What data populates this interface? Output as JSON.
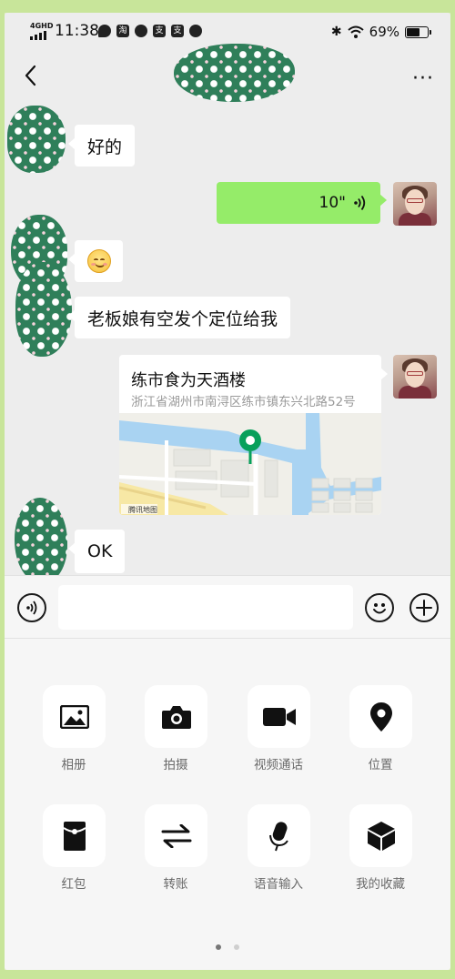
{
  "status_bar": {
    "network": "4GHD",
    "time": "11:38",
    "app_icons": [
      "chat-bubble-icon",
      "taobao-icon",
      "alipay-icon",
      "alipay-icon",
      "hd-icon"
    ],
    "app_icon_chars": [
      "",
      "淘",
      "",
      "支",
      "支"
    ],
    "battery_text": "69%",
    "battery_level": 0.69
  },
  "header": {
    "back_icon": "chevron-left-icon",
    "more_icon": "more-dots-icon",
    "more_label": "···"
  },
  "messages": [
    {
      "side": "left",
      "type": "text",
      "text": "好的"
    },
    {
      "side": "right",
      "type": "voice",
      "text": "10\""
    },
    {
      "side": "left",
      "type": "emoji",
      "emoji": "smiling-face"
    },
    {
      "side": "left",
      "type": "text",
      "text": "老板娘有空发个定位给我"
    },
    {
      "side": "right",
      "type": "location",
      "name": "练市食为天酒楼",
      "address": "浙江省湖州市南浔区练市镇东兴北路52号",
      "map_provider": "腾讯地图"
    },
    {
      "side": "left",
      "type": "text",
      "text": "OK"
    }
  ],
  "input_bar": {
    "voice_icon": "voice-mode-icon",
    "value": "",
    "emoji_icon": "emoji-icon",
    "plus_icon": "plus-icon"
  },
  "panel": {
    "items": [
      {
        "label": "相册",
        "icon": "photo-album-icon"
      },
      {
        "label": "拍摄",
        "icon": "camera-icon"
      },
      {
        "label": "视频通话",
        "icon": "video-call-icon"
      },
      {
        "label": "位置",
        "icon": "location-pin-icon"
      },
      {
        "label": "红包",
        "icon": "red-envelope-icon"
      },
      {
        "label": "转账",
        "icon": "transfer-icon"
      },
      {
        "label": "语音输入",
        "icon": "microphone-icon"
      },
      {
        "label": "我的收藏",
        "icon": "favorites-box-icon"
      }
    ],
    "page": 1,
    "pages": 2
  },
  "colors": {
    "chat_bg": "#ededed",
    "self_bubble": "#95ec69",
    "other_bubble": "#ffffff",
    "panel_bg": "#f6f6f6",
    "map_water": "#a9d3f2",
    "map_pin": "#07a05b",
    "privacy_blob": "#2f7f5a"
  }
}
